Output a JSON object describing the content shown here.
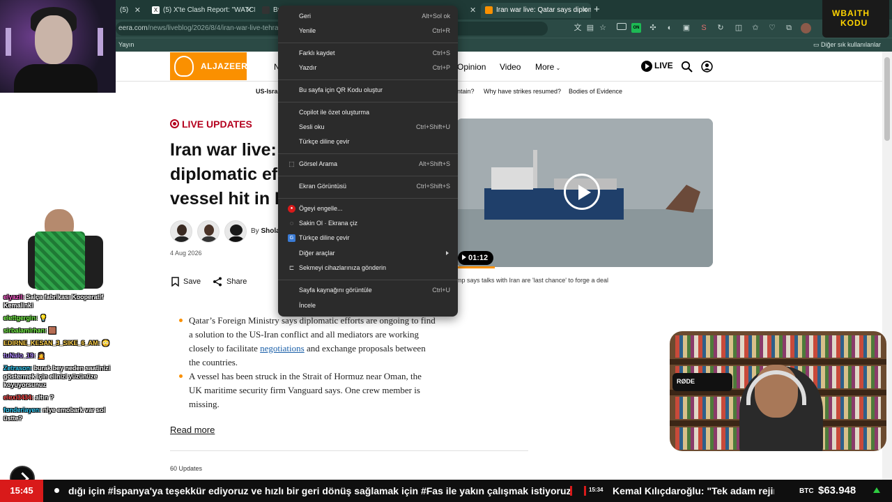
{
  "browser": {
    "tabs": [
      {
        "label": "(5)"
      },
      {
        "label": "(5) X'te Clash Report: \"WATCH: Ru"
      },
      {
        "label": "Bu"
      },
      {
        "label": "Iran war live: Qatar says diplomatic"
      }
    ],
    "url_prefix": "eera.com",
    "url_path": "/news/liveblog/2026/8/4/iran-war-live-tehran-c",
    "bookmark_left": "Yayın",
    "bookmark_right": "Diğer sık kullanılanlar"
  },
  "site": {
    "logo_text": "ALJAZEERA",
    "nav_partial": "N",
    "nav": [
      "Opinion",
      "Video",
      "More"
    ],
    "live_label": "LIVE",
    "subnav_first": "US-Isra",
    "subnav": [
      "ntain?",
      "Why have strikes resumed?",
      "Bodies of Evidence"
    ]
  },
  "article": {
    "live_updates": "LIVE UPDATES",
    "headline_lines": [
      "Iran war live:",
      "diplomatic ef",
      "vessel hit in I"
    ],
    "byline_prefix": "By ",
    "byline_name": "Shola",
    "date": "4 Aug 2026",
    "save_label": "Save",
    "share_label": "Share",
    "bullet1_pre": "Qatar’s Foreign Ministry says diplomatic efforts are ongoing to find a solution to the US-Iran conflict and all mediators are working closely to facilitate ",
    "bullet1_link": "negotiations",
    "bullet1_post": " and exchange proposals between the countries.",
    "bullet2": "A vessel has been struck in the Strait of Hormuz near Oman, the UK maritime security firm Vanguard says. One crew member is missing.",
    "read_more": "Read more",
    "updates_count": "60 Updates",
    "video_duration": "01:12",
    "video_caption": "mp says talks with Iran are 'last chance' to forge a deal"
  },
  "context_menu": {
    "items": [
      {
        "label": "Geri",
        "shortcut": "Alt+Sol ok",
        "icon": ""
      },
      {
        "label": "Yenile",
        "shortcut": "Ctrl+R",
        "icon": ""
      },
      {
        "label": "Farklı kaydet",
        "shortcut": "Ctrl+S",
        "icon": ""
      },
      {
        "label": "Yazdır",
        "shortcut": "Ctrl+P",
        "icon": ""
      },
      {
        "label": "Bu sayfa için QR Kodu oluştur",
        "shortcut": "",
        "icon": ""
      },
      {
        "label": "Copilot ile özet oluşturma",
        "shortcut": "",
        "icon": ""
      },
      {
        "label": "Sesli oku",
        "shortcut": "Ctrl+Shift+U",
        "icon": ""
      },
      {
        "label": "Türkçe diline çevir",
        "shortcut": "",
        "icon": ""
      },
      {
        "label": "Görsel Arama",
        "shortcut": "Alt+Shift+S",
        "icon": "visual-search-icon"
      },
      {
        "label": "Ekran Görüntüsü",
        "shortcut": "Ctrl+Shift+S",
        "icon": ""
      },
      {
        "label": "Ögeyi engelle...",
        "shortcut": "",
        "icon": "adblock-icon"
      },
      {
        "label": "Sakin Ol · Ekrana çiz",
        "shortcut": "",
        "icon": "draw-icon"
      },
      {
        "label": "Türkçe diline çevir",
        "shortcut": "",
        "icon": "translate-icon"
      },
      {
        "label": "Diğer araçlar",
        "shortcut": "",
        "icon": ""
      },
      {
        "label": "Sekmeyi cihazlarınıza gönderin",
        "shortcut": "",
        "icon": "send-tab-icon"
      },
      {
        "label": "Sayfa kaynağını görüntüle",
        "shortcut": "Ctrl+U",
        "icon": ""
      },
      {
        "label": "İncele",
        "shortcut": "",
        "icon": ""
      }
    ]
  },
  "stream": {
    "brand_line1": "WBAITH",
    "brand_line2": "KODU",
    "mic_label": "RØDE",
    "chat": [
      {
        "user": "elyazil:",
        "msg": "Salça fabrikası Kooperatif Kemalinki"
      },
      {
        "user": "elettgergin:",
        "msg": "💡"
      },
      {
        "user": "sirbalamirhan:",
        "msg": "🟫"
      },
      {
        "user": "EDIRNE_KESAN_3_SIKE_6_AM:",
        "msg": "😳"
      },
      {
        "user": "tuNalo_19:",
        "msg": "🙍"
      },
      {
        "user": "Zetrason:",
        "msg": "burak bey neden saatinizi göstermek için elinizi yüzünüze koyuyorsunuz"
      },
      {
        "user": "elexi3434:",
        "msg": "altın ?"
      },
      {
        "user": "fonderiayen:",
        "msg": "niye emobark var sol üstte?"
      }
    ],
    "ticker_time": "15:45",
    "ticker_text": "dığı için #İspanya'ya teşekkür ediyoruz ve hızlı bir geri dönüş sağlamak için #Fas ile yakın çalışmak istiyoruz",
    "ticker_time2": "15:34",
    "ticker_text2": "Kemal Kılıçdaroğlu: \"Tek adam rejim",
    "btc_label": "BTC",
    "btc_value": "$63.948"
  }
}
